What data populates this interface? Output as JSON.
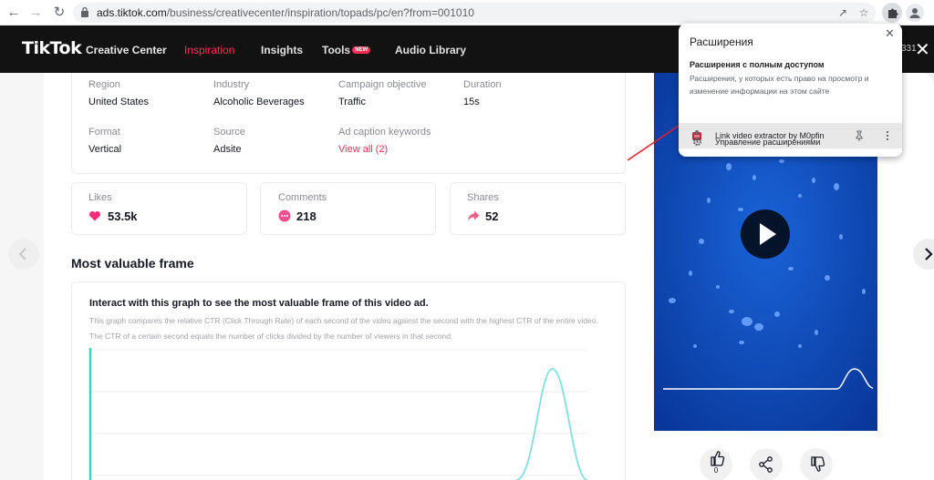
{
  "browser": {
    "url_host": "ads.tiktok.com",
    "url_path": "/business/creativecenter/inspiration/topads/pc/en?from=001010"
  },
  "header": {
    "logo": "TikTok",
    "logo_sub": "Creative Center",
    "nav": [
      {
        "label": "Inspiration",
        "active": true
      },
      {
        "label": "Insights"
      },
      {
        "label": "Tools",
        "badge": "NEW"
      },
      {
        "label": "Audio Library"
      }
    ],
    "right_number": "331"
  },
  "details": {
    "region": {
      "label": "Region",
      "value": "United States"
    },
    "industry": {
      "label": "Industry",
      "value": "Alcoholic Beverages"
    },
    "objective": {
      "label": "Campaign objective",
      "value": "Traffic"
    },
    "duration": {
      "label": "Duration",
      "value": "15s"
    },
    "format": {
      "label": "Format",
      "value": "Vertical"
    },
    "source": {
      "label": "Source",
      "value": "Adsite"
    },
    "keywords": {
      "label": "Ad caption keywords",
      "value": "View all (2)"
    }
  },
  "stats": {
    "likes": {
      "label": "Likes",
      "value": "53.5k"
    },
    "comments": {
      "label": "Comments",
      "value": "218"
    },
    "shares": {
      "label": "Shares",
      "value": "52"
    }
  },
  "frame_section": {
    "title": "Most valuable frame",
    "graph_title": "Interact with this graph to see the most valuable frame of this video ad.",
    "graph_desc": "This graph compares the relative CTR (Click Through Rate) of each second of the video against the second with the highest CTR of the entire video. The CTR of a certain second equals the number of clicks divided by the number of viewers in that second."
  },
  "video_actions": {
    "like_count": "0"
  },
  "extensions_popup": {
    "title": "Расширения",
    "subtitle": "Расширения с полным доступом",
    "description": "Расширения, у которых есть право на просмотр и изменение информации на этом сайте",
    "item_label": "Link video extractor by M0pfin",
    "manage_label": "Управление расширениями"
  },
  "colors": {
    "brand_red": "#fe2c55",
    "likes_pink": "#fe2c7a",
    "comments_pink": "#f24f8f",
    "shares_pink": "#f25f86",
    "video_blue": "#0c46b8",
    "graph_line": "#7fe0e0"
  }
}
